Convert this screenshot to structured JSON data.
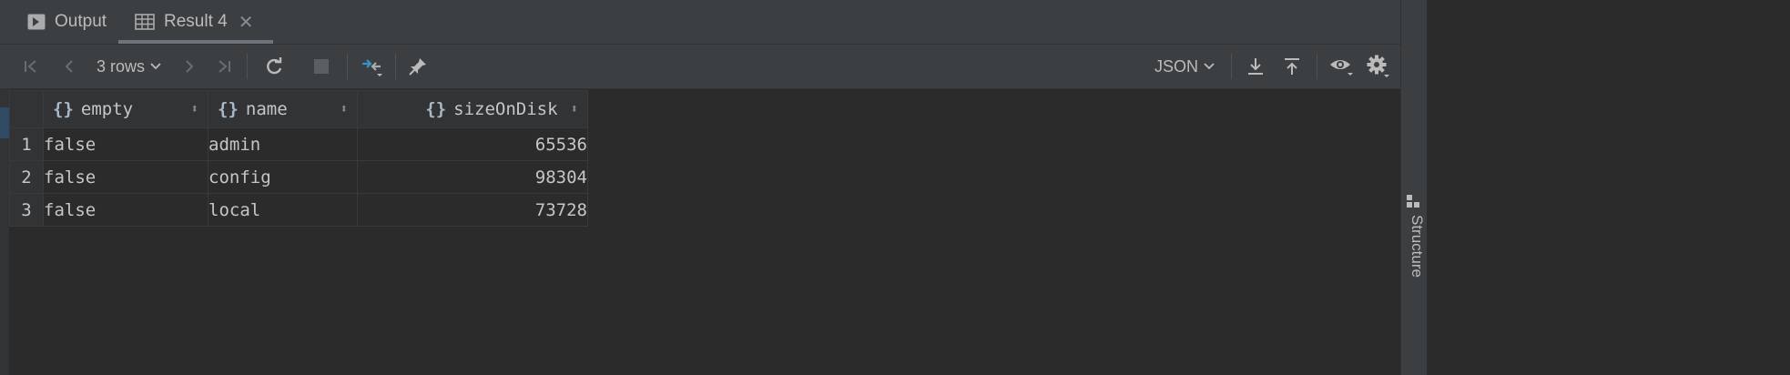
{
  "tabs": [
    {
      "label": "Output",
      "icon": "console-play-icon"
    },
    {
      "label": "Result 4",
      "icon": "table-icon",
      "active": true
    }
  ],
  "toolbar": {
    "rows_label": "3 rows",
    "format_label": "JSON",
    "icons": [
      "first-page-icon",
      "prev-page-icon",
      "next-page-icon",
      "last-page-icon",
      "refresh-icon",
      "stop-icon",
      "compare-icon",
      "pin-icon",
      "download-icon",
      "upload-icon",
      "view-icon",
      "settings-icon"
    ]
  },
  "table": {
    "columns": [
      {
        "label": "empty"
      },
      {
        "label": "name"
      },
      {
        "label": "sizeOnDisk"
      }
    ],
    "rows": [
      {
        "num": "1",
        "empty": "false",
        "name": "admin",
        "sizeOnDisk": "65536"
      },
      {
        "num": "2",
        "empty": "false",
        "name": "config",
        "sizeOnDisk": "98304"
      },
      {
        "num": "3",
        "empty": "false",
        "name": "local",
        "sizeOnDisk": "73728"
      }
    ]
  },
  "sidebar": {
    "structure_label": "Structure"
  },
  "colors": {
    "background": "#2b2b2b",
    "panel": "#3c3f41",
    "accent_blue": "#3592c4"
  }
}
